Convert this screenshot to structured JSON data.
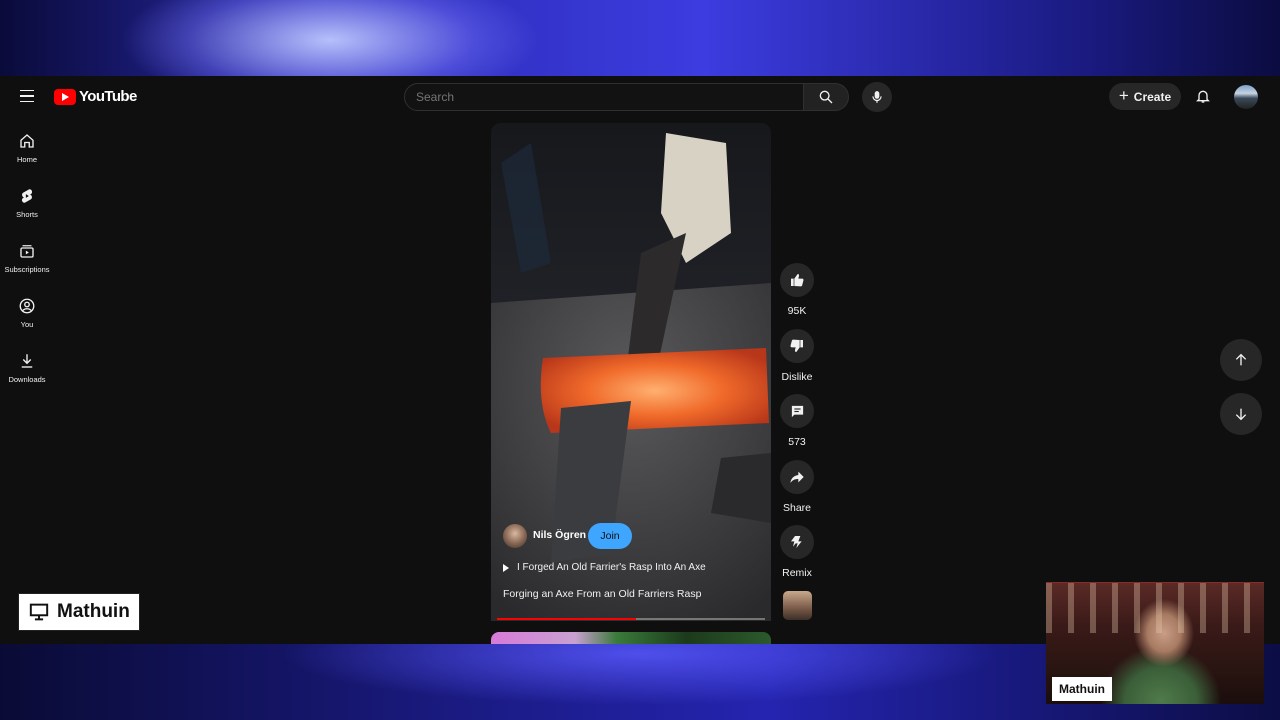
{
  "app": {
    "logo_text": "YouTube",
    "brand_color": "#ff0000",
    "accent_color": "#3ea6ff"
  },
  "header": {
    "search_placeholder": "Search",
    "create_label": "Create"
  },
  "sidebar": {
    "items": [
      {
        "label": "Home",
        "icon": "home-icon"
      },
      {
        "label": "Shorts",
        "icon": "shorts-icon"
      },
      {
        "label": "Subscriptions",
        "icon": "subscriptions-icon"
      },
      {
        "label": "You",
        "icon": "you-icon"
      },
      {
        "label": "Downloads",
        "icon": "download-icon"
      }
    ]
  },
  "short": {
    "channel_name": "Nils Ögren",
    "join_label": "Join",
    "playlist_title": "I Forged An Old Farrier's Rasp Into An Axe",
    "title": "Forging an Axe From an Old Farriers Rasp",
    "progress_fraction": 0.52
  },
  "actions": {
    "likes": "95K",
    "dislike_label": "Dislike",
    "comments": "573",
    "share_label": "Share",
    "remix_label": "Remix"
  },
  "overlay": {
    "streamer_tag": "Mathuin",
    "webcam_label": "Mathuin"
  }
}
